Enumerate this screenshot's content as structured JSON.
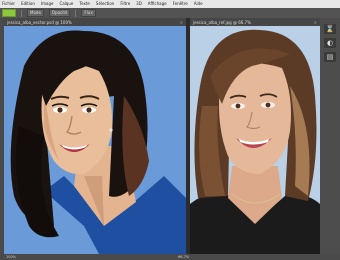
{
  "menu": {
    "items": [
      "Fichier",
      "Edition",
      "Image",
      "Calque",
      "Texte",
      "Sélection",
      "Filtre",
      "3D",
      "Affichage",
      "Fenêtre",
      "Aide"
    ]
  },
  "options": {
    "mode_label": "Mode",
    "opacity_label": "Opacité",
    "flow_label": "Flux"
  },
  "tabs": {
    "left": "jessica_alba_vector.psd @ 100%",
    "right": "jessica_alba_ref.jpg @ 66.7%"
  },
  "right_panel": {
    "icons": [
      "history-icon",
      "adjustments-icon",
      "layers-icon"
    ]
  },
  "status": {
    "left_zoom": "100%",
    "right_zoom": "66.7%"
  },
  "colors": {
    "canvas_bg_left": "#6b9ad8",
    "canvas_bg_right": "#b9d0e6",
    "dress": "#1f4fa0",
    "hair": "#1a120f",
    "skin_vector": "#e8bf9a",
    "skin_photo": "#e6b89a"
  }
}
